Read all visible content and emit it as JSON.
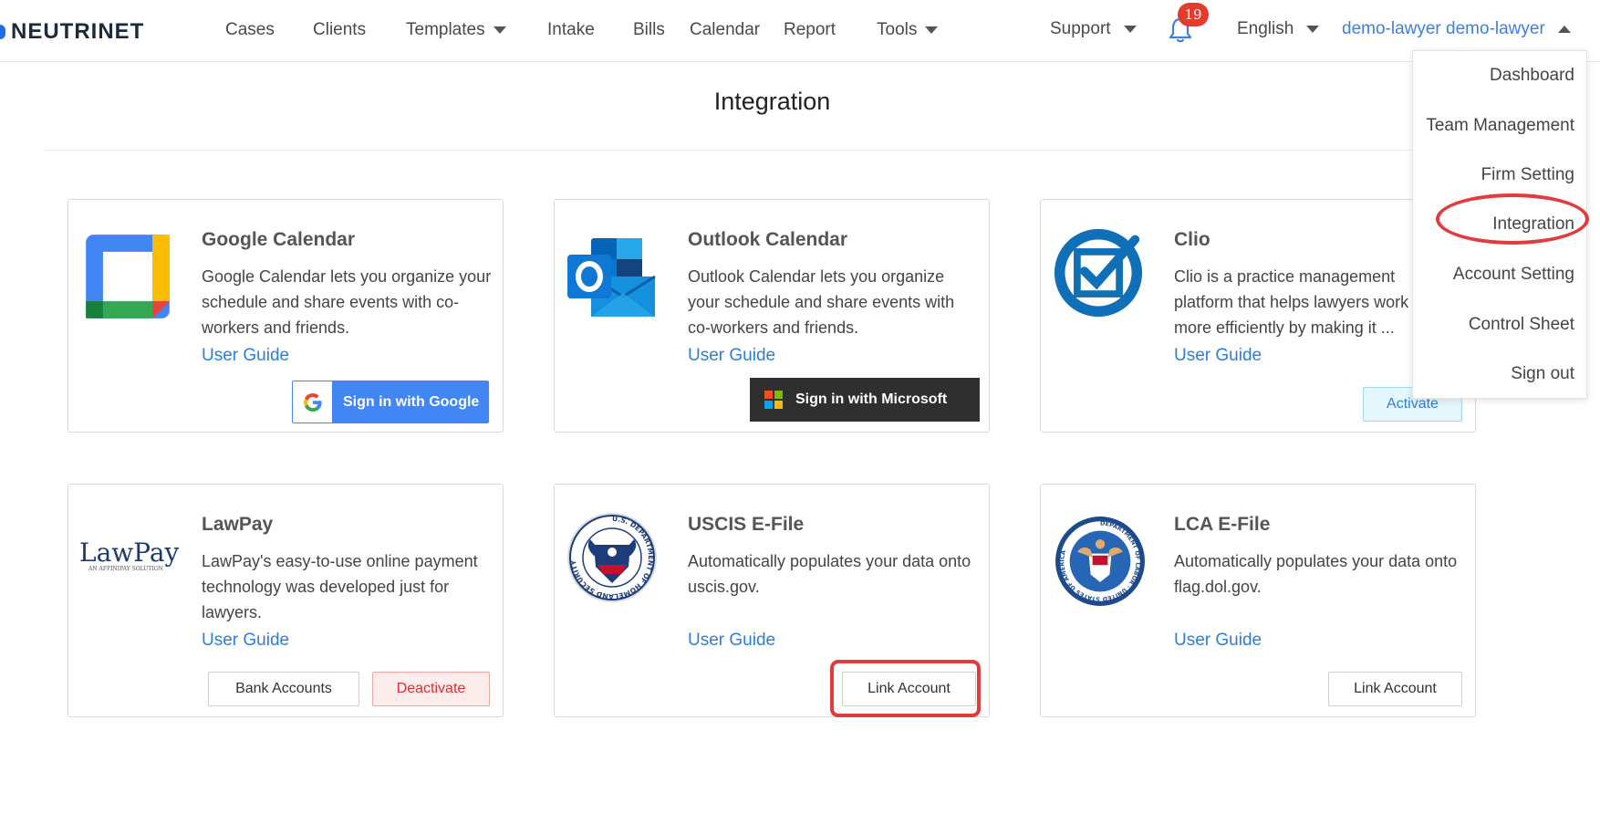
{
  "brand": {
    "name": "NEUTRINET"
  },
  "nav": {
    "items": [
      "Cases",
      "Clients",
      "Templates",
      "Intake",
      "Bills",
      "Calendar",
      "Report",
      "Tools"
    ],
    "support": "Support",
    "notifications_count": "19",
    "language": "English",
    "user": "demo-lawyer demo-lawyer"
  },
  "page": {
    "title": "Integration"
  },
  "cards": [
    {
      "title": "Google Calendar",
      "description": "Google Calendar lets you organize your schedule and share events with co-workers and friends.",
      "guide": "User Guide",
      "action": "Sign in with Google"
    },
    {
      "title": "Outlook Calendar",
      "description": "Outlook Calendar lets you organize your schedule and share events with co-workers and friends.",
      "guide": "User Guide",
      "action": "Sign in with Microsoft"
    },
    {
      "title": "Clio",
      "description": "Clio is a practice management platform that helps lawyers work more efficiently by making it ...",
      "guide": "User Guide",
      "action": "Activate"
    },
    {
      "title": "LawPay",
      "logo_text": "LawPay",
      "logo_subtext": "AN AFFINIPAY SOLUTION",
      "description": "LawPay's easy-to-use online payment technology was developed just for lawyers.",
      "guide": "User Guide",
      "action_secondary": "Bank Accounts",
      "action": "Deactivate"
    },
    {
      "title": "USCIS E-File",
      "logo_ring_text": "U.S. DEPARTMENT OF HOMELAND SECURITY",
      "description": "Automatically populates your data onto uscis.gov.",
      "guide": "User Guide",
      "action": "Link Account"
    },
    {
      "title": "LCA E-File",
      "logo_ring_text": "DEPARTMENT OF LABOR · UNITED STATES OF AMERICA",
      "description": "Automatically populates your data onto flag.dol.gov.",
      "guide": "User Guide",
      "action": "Link Account"
    }
  ],
  "user_menu": [
    "Dashboard",
    "Team Management",
    "Firm Setting",
    "Integration",
    "Account Setting",
    "Control Sheet",
    "Sign out"
  ],
  "colors": {
    "link": "#2b7fd9",
    "google_blue": "#4285f4",
    "microsoft_dark": "#2f2f2f",
    "badge_red": "#e53b2c",
    "annotation_red": "#e23b3b",
    "danger_red": "#d93030"
  },
  "icons": {
    "logo": "neutrinet-logo",
    "bell": "bell-icon",
    "google_calendar": "google-calendar-icon",
    "outlook": "outlook-icon",
    "clio": "clio-check-icon",
    "lawpay": "lawpay-logo",
    "dhs": "dhs-seal-icon",
    "dol": "dol-seal-icon"
  }
}
